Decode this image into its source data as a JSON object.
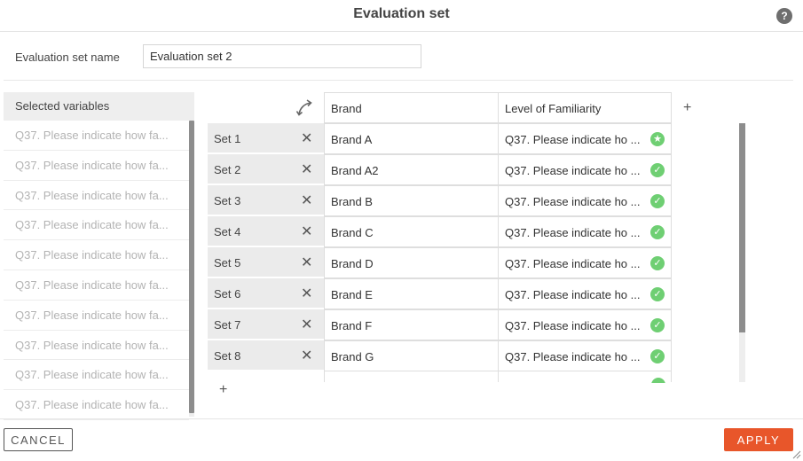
{
  "dialog": {
    "title": "Evaluation set",
    "help_icon": "question-circle-icon",
    "help_glyph": "?"
  },
  "form": {
    "name_label": "Evaluation set name",
    "name_value": "Evaluation set 2"
  },
  "variables": {
    "header": "Selected variables",
    "items": [
      "Q37. Please indicate how fa...",
      "Q37. Please indicate how fa...",
      "Q37. Please indicate how fa...",
      "Q37. Please indicate how fa...",
      "Q37. Please indicate how fa...",
      "Q37. Please indicate how fa...",
      "Q37. Please indicate how fa...",
      "Q37. Please indicate how fa...",
      "Q37. Please indicate how fa...",
      "Q37. Please indicate how fa..."
    ]
  },
  "grid": {
    "columns": [
      "Brand",
      "Level of Familiarity"
    ],
    "add_column_glyph": "+",
    "add_row_glyph": "+",
    "remove_glyph": "✕",
    "rows": [
      {
        "set": "Set 1",
        "brand": "Brand A",
        "familiarity": "Q37. Please indicate ho  ...",
        "status": "star-check-icon"
      },
      {
        "set": "Set 2",
        "brand": "Brand A2",
        "familiarity": "Q37. Please indicate ho  ...",
        "status": "check-circle-icon"
      },
      {
        "set": "Set 3",
        "brand": "Brand B",
        "familiarity": "Q37. Please indicate ho  ...",
        "status": "check-circle-icon"
      },
      {
        "set": "Set 4",
        "brand": "Brand C",
        "familiarity": "Q37. Please indicate ho  ...",
        "status": "check-circle-icon"
      },
      {
        "set": "Set 5",
        "brand": "Brand D",
        "familiarity": "Q37. Please indicate ho  ...",
        "status": "check-circle-icon"
      },
      {
        "set": "Set 6",
        "brand": "Brand E",
        "familiarity": "Q37. Please indicate ho  ...",
        "status": "check-circle-icon"
      },
      {
        "set": "Set 7",
        "brand": "Brand F",
        "familiarity": "Q37. Please indicate ho  ...",
        "status": "check-circle-icon"
      },
      {
        "set": "Set 8",
        "brand": "Brand G",
        "familiarity": "Q37. Please indicate ho  ...",
        "status": "check-circle-icon"
      }
    ]
  },
  "footer": {
    "cancel_label": "CANCEL",
    "apply_label": "APPLY"
  },
  "colors": {
    "accent": "#e8562a",
    "check": "#6fcf73",
    "set_cell_bg": "#ebebeb"
  }
}
